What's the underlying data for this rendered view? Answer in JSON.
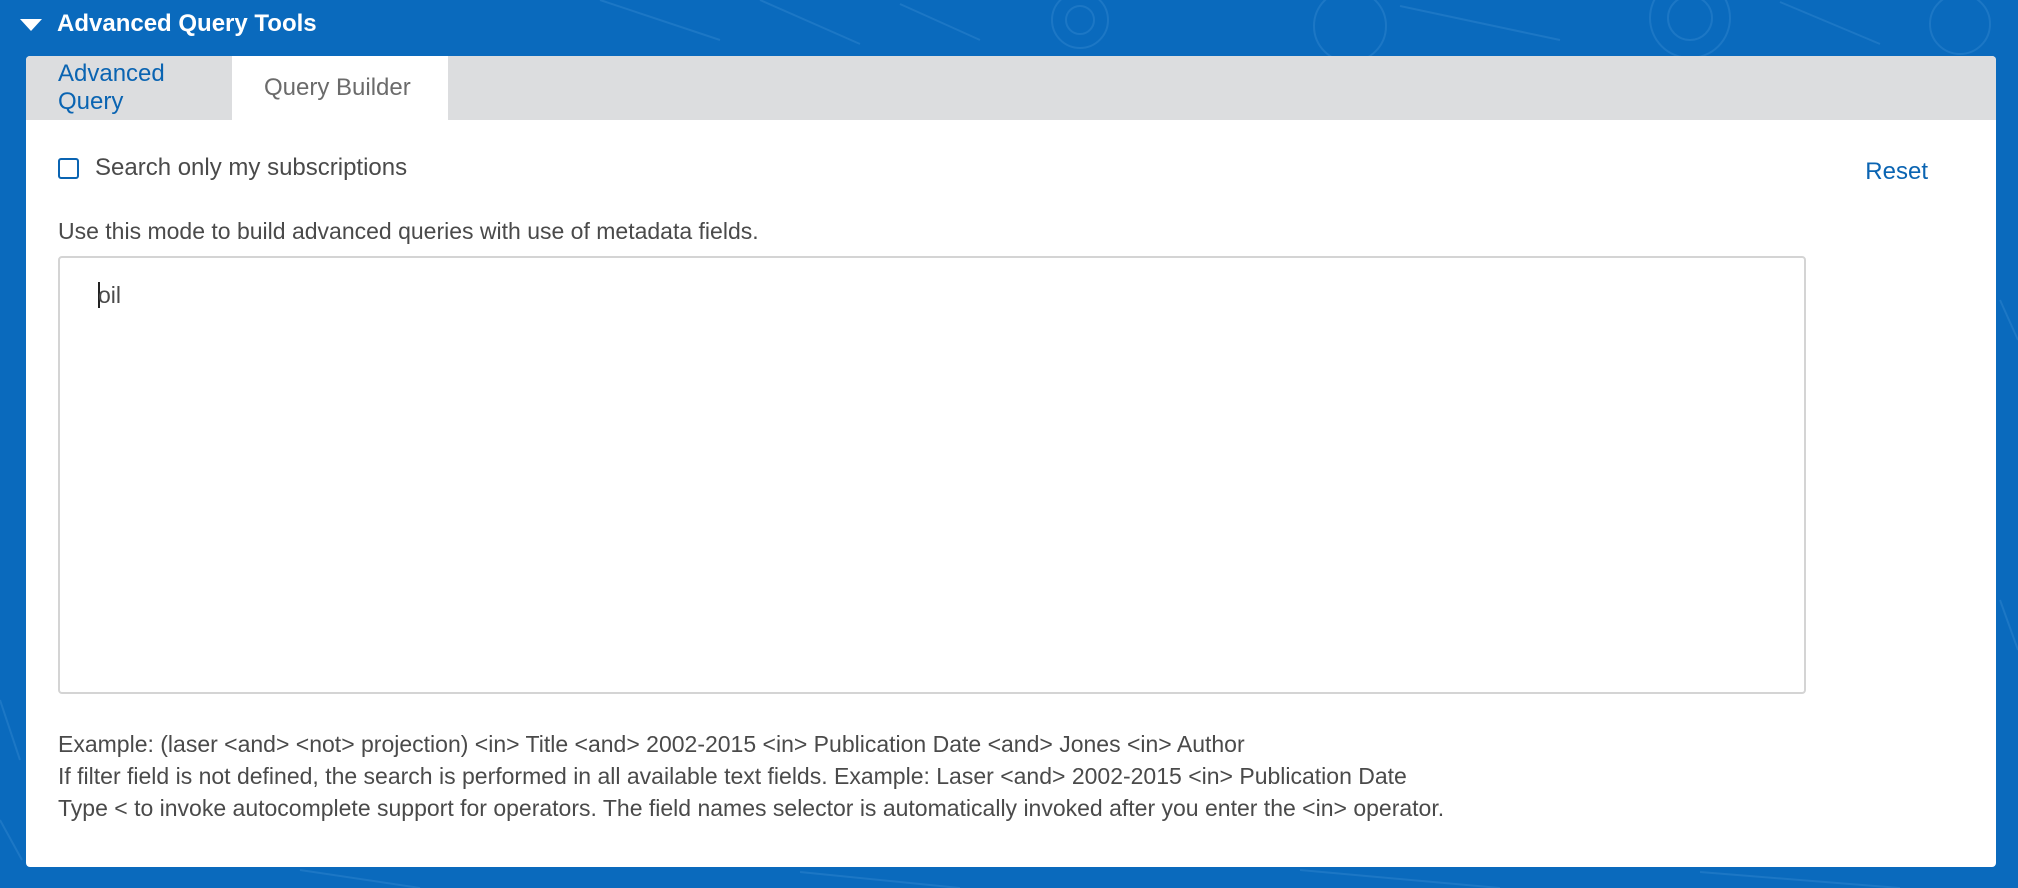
{
  "panel": {
    "title": "Advanced Query Tools"
  },
  "tabs": [
    {
      "label": "Advanced Query",
      "active": false
    },
    {
      "label": "Query Builder",
      "active": true
    }
  ],
  "options": {
    "subscriptions_label": "Search only my subscriptions",
    "subscriptions_checked": false,
    "reset_label": "Reset"
  },
  "query": {
    "description": "Use this mode to build advanced queries with use of metadata fields.",
    "value": "oil"
  },
  "help": {
    "line1": "Example: (laser <and> <not> projection) <in> Title <and> 2002-2015 <in> Publication Date <and> Jones <in> Author",
    "line2": "If filter field is not defined, the search is performed in all available text fields. Example: Laser <and> 2002-2015 <in> Publication Date",
    "line3": "Type < to invoke autocomplete support for operators. The field names selector is automatically invoked after you enter the <in> operator."
  },
  "colors": {
    "background": "#0a6abd",
    "link": "#0a64b2",
    "tabbar": "#dcdddf",
    "text": "#4a4a4a"
  }
}
